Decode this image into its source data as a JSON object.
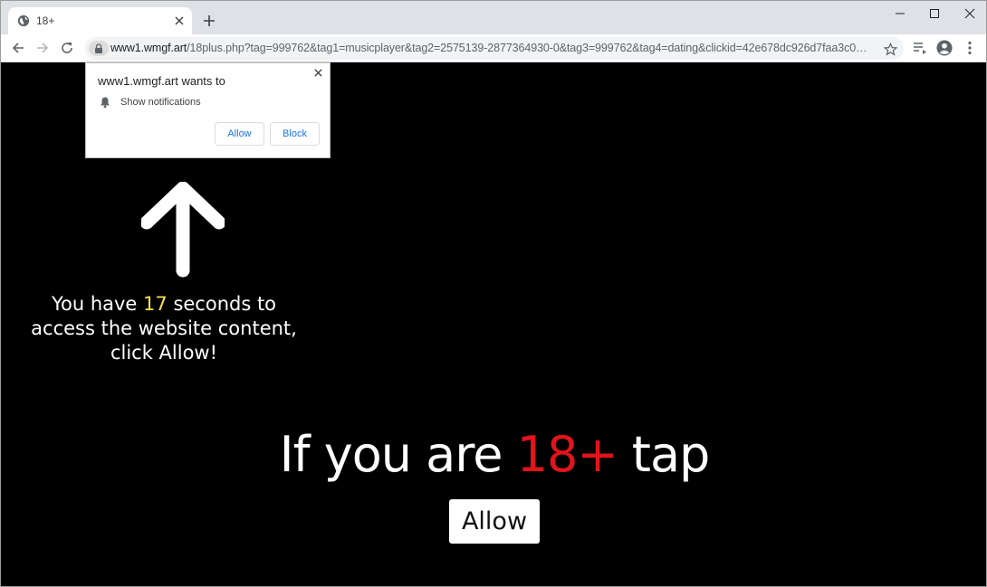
{
  "browser": {
    "tab": {
      "title": "18+",
      "favicon": "globe-icon"
    },
    "window_controls": [
      "minimize-icon",
      "maximize-icon",
      "close-icon"
    ],
    "url": {
      "domain": "www1.wmgf.art",
      "path": "/18plus.php?tag=999762&tag1=musicplayer&tag2=2575139-2877364930-0&tag3=999762&tag4=dating&clickid=42e678dc926d7faa3c03fa1..."
    }
  },
  "popup": {
    "title": "www1.wmgf.art wants to",
    "permission": "Show notifications",
    "allow": "Allow",
    "block": "Block"
  },
  "page": {
    "countdown": {
      "pre": "You have ",
      "seconds": "17",
      "post": " seconds to access the website content, click Allow!"
    },
    "headline": {
      "pre": "If you are ",
      "highlight": "18+",
      "post": " tap"
    },
    "allow_button": "Allow"
  },
  "colors": {
    "highlight_red": "#e3131b",
    "countdown_yellow": "#f4e24a",
    "link_blue": "#1a73e8"
  }
}
